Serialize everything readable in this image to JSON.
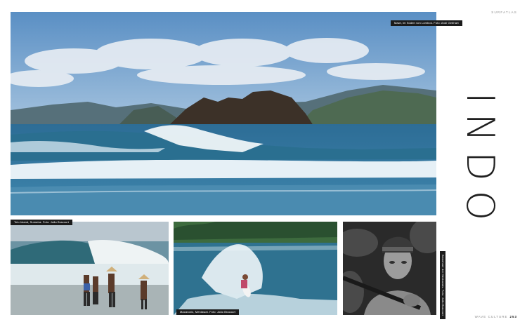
{
  "header": {
    "section_label": "SURFATLAS"
  },
  "title": "INDO",
  "footer": {
    "magazine": "WAVE CULTURE",
    "page_number": "253"
  },
  "photos": {
    "hero": {
      "caption": "Mawi, im Süden von Lombok. Foto: Andi Gebhart"
    },
    "bottom_left": {
      "caption": "Telo Island, Sumatra. Foto: João Bracourt"
    },
    "bottom_middle": {
      "caption": "Macaronis, Mentawai. Foto: João Bracourt"
    },
    "bottom_right": {
      "caption": "Bewohner der Mentawais. Foto: João Bracourt"
    }
  }
}
